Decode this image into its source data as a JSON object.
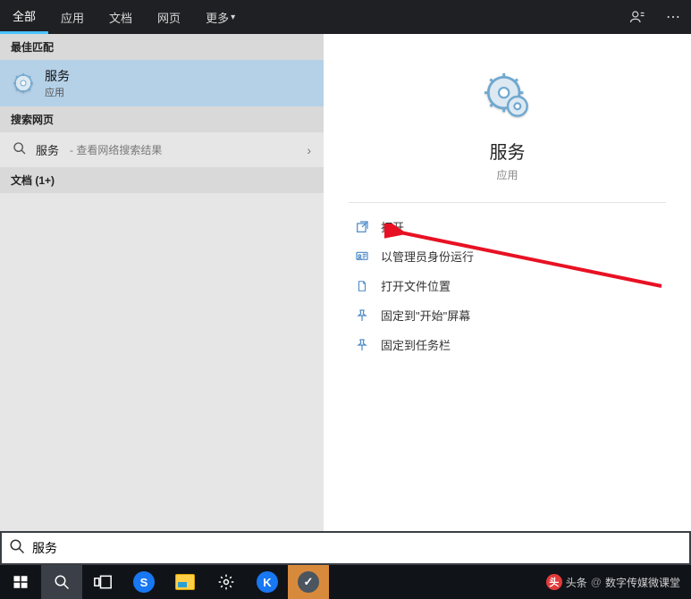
{
  "tabs": {
    "all": "全部",
    "apps": "应用",
    "docs": "文档",
    "web": "网页",
    "more": "更多"
  },
  "left": {
    "best_match_header": "最佳匹配",
    "best_match_title": "服务",
    "best_match_sub": "应用",
    "search_web_header": "搜索网页",
    "web_row_label": "服务",
    "web_row_hint": "- 查看网络搜索结果",
    "docs_header": "文档 (1+)"
  },
  "right": {
    "app_title": "服务",
    "app_sub": "应用",
    "actions": {
      "open": "打开",
      "run_admin": "以管理员身份运行",
      "open_location": "打开文件位置",
      "pin_start": "固定到\"开始\"屏幕",
      "pin_taskbar": "固定到任务栏"
    }
  },
  "search": {
    "value": "服务"
  },
  "credit": {
    "label": "头条",
    "at": "@",
    "author": "数字传媒微课堂"
  }
}
